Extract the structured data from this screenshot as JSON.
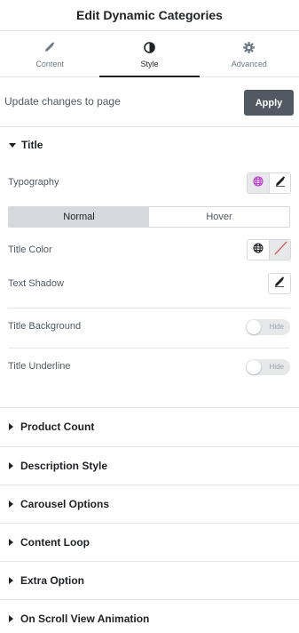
{
  "header": {
    "title": "Edit Dynamic Categories"
  },
  "tabs": [
    {
      "label": "Content",
      "icon": "pencil-icon"
    },
    {
      "label": "Style",
      "icon": "half-circle-icon",
      "active": true
    },
    {
      "label": "Advanced",
      "icon": "gear-icon"
    }
  ],
  "update": {
    "text": "Update changes to page",
    "apply_label": "Apply"
  },
  "title_section": {
    "heading": "Title",
    "typography_label": "Typography",
    "states": [
      "Normal",
      "Hover"
    ],
    "active_state": "Normal",
    "title_color_label": "Title Color",
    "text_shadow_label": "Text Shadow",
    "title_background_label": "Title Background",
    "title_background_switch": "Hide",
    "title_underline_label": "Title Underline",
    "title_underline_switch": "Hide"
  },
  "collapsed_sections": [
    "Product Count",
    "Description Style",
    "Carousel Options",
    "Content Loop",
    "Extra Option",
    "On Scroll View Animation"
  ],
  "colors": {
    "apply_bg": "#515962",
    "globe_active": "#c036d2",
    "clear_red": "#e0424a"
  }
}
